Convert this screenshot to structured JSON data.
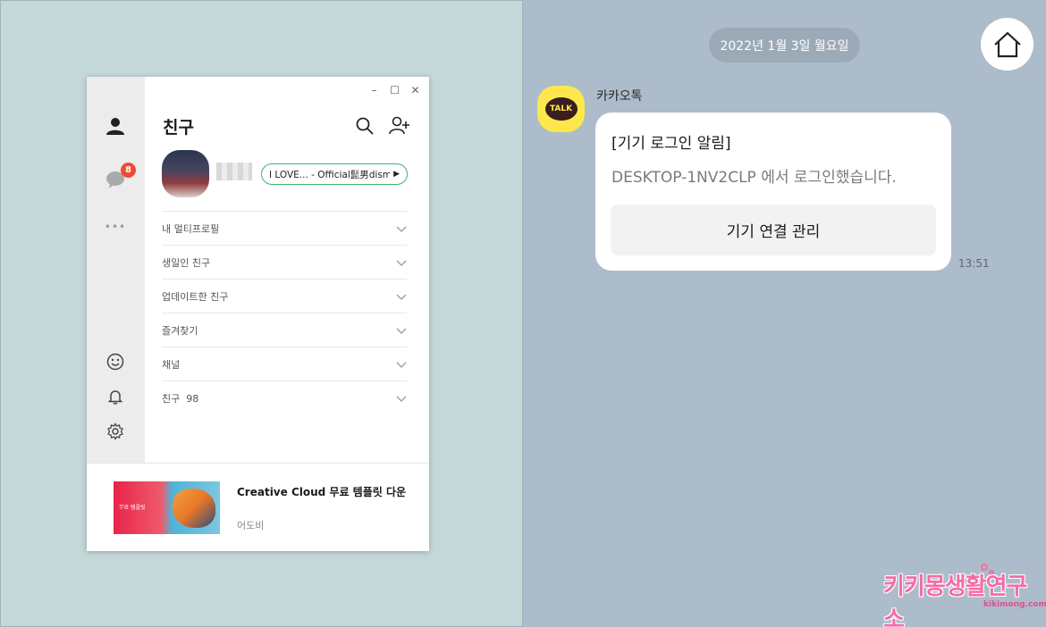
{
  "window": {
    "title": "친구",
    "controls": {
      "minimize": "–",
      "maximize": "☐",
      "close": "✕"
    },
    "sidebar": {
      "chat_badge": "8",
      "more_label": "•••"
    },
    "profile": {
      "music_status": "I LOVE... - Official髭男dism"
    },
    "sections": [
      {
        "label": "내 멀티프로필"
      },
      {
        "label": "생일인 친구"
      },
      {
        "label": "업데이트한 친구"
      },
      {
        "label": "즐겨찾기"
      },
      {
        "label": "채널"
      },
      {
        "label": "친구  98"
      }
    ],
    "ad": {
      "title": "Creative Cloud 무료 템플릿 다운",
      "sponsor": "어도비",
      "image_text": "무료 템플릿"
    }
  },
  "chat": {
    "date": "2022년 1월 3일 월요일",
    "sender": "카카오톡",
    "avatar_text": "TALK",
    "message_title": "[기기 로그인 알림]",
    "message_body": "DESKTOP-1NV2CLP 에서 로그인했습니다.",
    "button_label": "기기 연결 관리",
    "time": "13:51"
  },
  "watermark": {
    "text": "키키몽생활연구소",
    "url": "kikimong.com"
  },
  "colors": {
    "left_bg": "#c5d8d9",
    "right_bg": "#acbcca",
    "kakao_yellow": "#fde74c",
    "badge_red": "#f04a33",
    "music_green": "#3db36a"
  }
}
